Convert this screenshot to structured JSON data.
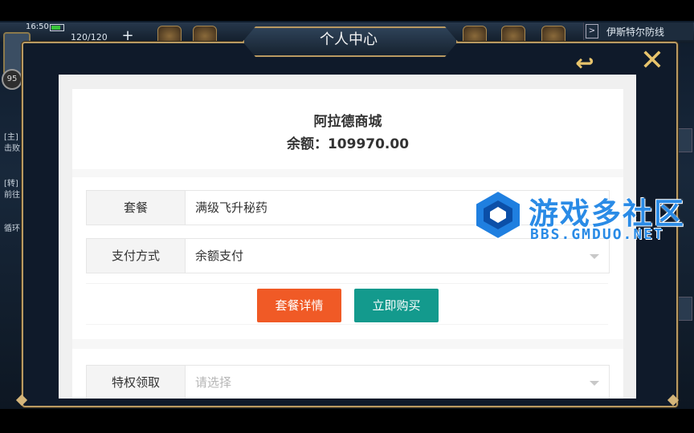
{
  "status": {
    "time": "16:50",
    "stamina": "120/120",
    "plus": "+",
    "level": "95"
  },
  "region": {
    "arrow": ">",
    "name": "伊斯特尔防线"
  },
  "side_left": [
    "[主]",
    "击败",
    "[转]",
    "前往",
    "循环"
  ],
  "modal": {
    "title": "个人中心",
    "store_name": "阿拉德商城",
    "balance_label": "余额：",
    "balance_value": "109970.00",
    "rows": [
      {
        "label": "套餐",
        "value": "满级飞升秘药"
      },
      {
        "label": "支付方式",
        "value": "余额支付"
      },
      {
        "label": "特权领取",
        "value": "请选择"
      }
    ],
    "buttons": {
      "detail": "套餐详情",
      "buy": "立即购买"
    },
    "colors": {
      "detail": "#f05a26",
      "buy": "#139a8d",
      "frame": "#b99a62"
    }
  },
  "watermark": {
    "title": "游戏多社区",
    "url": "BBS.GMDUO.NET"
  },
  "icons": {
    "back": "back-arrow-icon",
    "close": "close-x-icon"
  }
}
